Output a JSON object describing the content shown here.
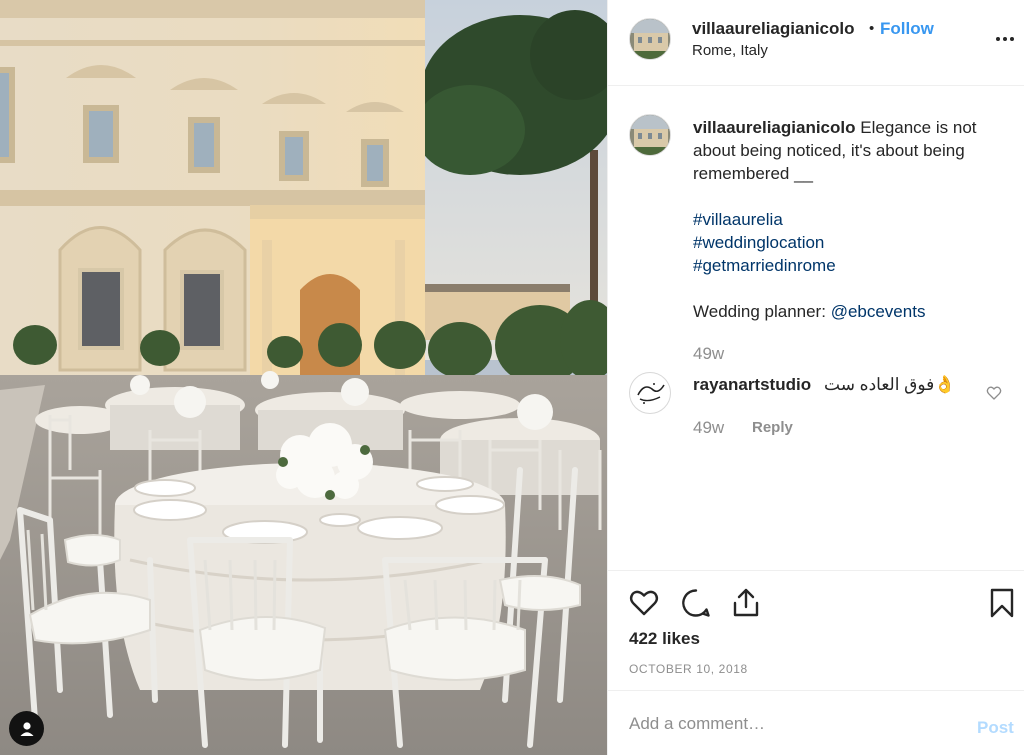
{
  "post": {
    "username": "villaaureliagianicolo",
    "separator": "•",
    "follow_label": "Follow",
    "location": "Rome, Italy",
    "more_icon": "more-horizontal-icon"
  },
  "caption": {
    "username": "villaaureliagianicolo",
    "text": "Elegance is not about being noticed, it's about being remembered __",
    "hashtags": [
      "#villaaurelia",
      "#weddinglocation",
      "#getmarriedinrome"
    ],
    "planner_label": "Wedding planner:",
    "planner_mention": "@ebcevents",
    "age": "49w"
  },
  "comments": [
    {
      "username": "rayanartstudio",
      "text": "فوق العاده ست👌",
      "age": "49w",
      "reply_label": "Reply"
    }
  ],
  "actions": {
    "like_icon": "heart-icon",
    "comment_icon": "comment-icon",
    "share_icon": "share-icon",
    "save_icon": "bookmark-icon"
  },
  "likes": "422 likes",
  "date": "OCTOBER 10, 2018",
  "add_comment": {
    "placeholder": "Add a comment…",
    "post_label": "Post"
  },
  "colors": {
    "link": "#3897f0",
    "hashtag": "#003569",
    "muted": "#8e8e8e",
    "post_disabled": "#b3dbff"
  }
}
